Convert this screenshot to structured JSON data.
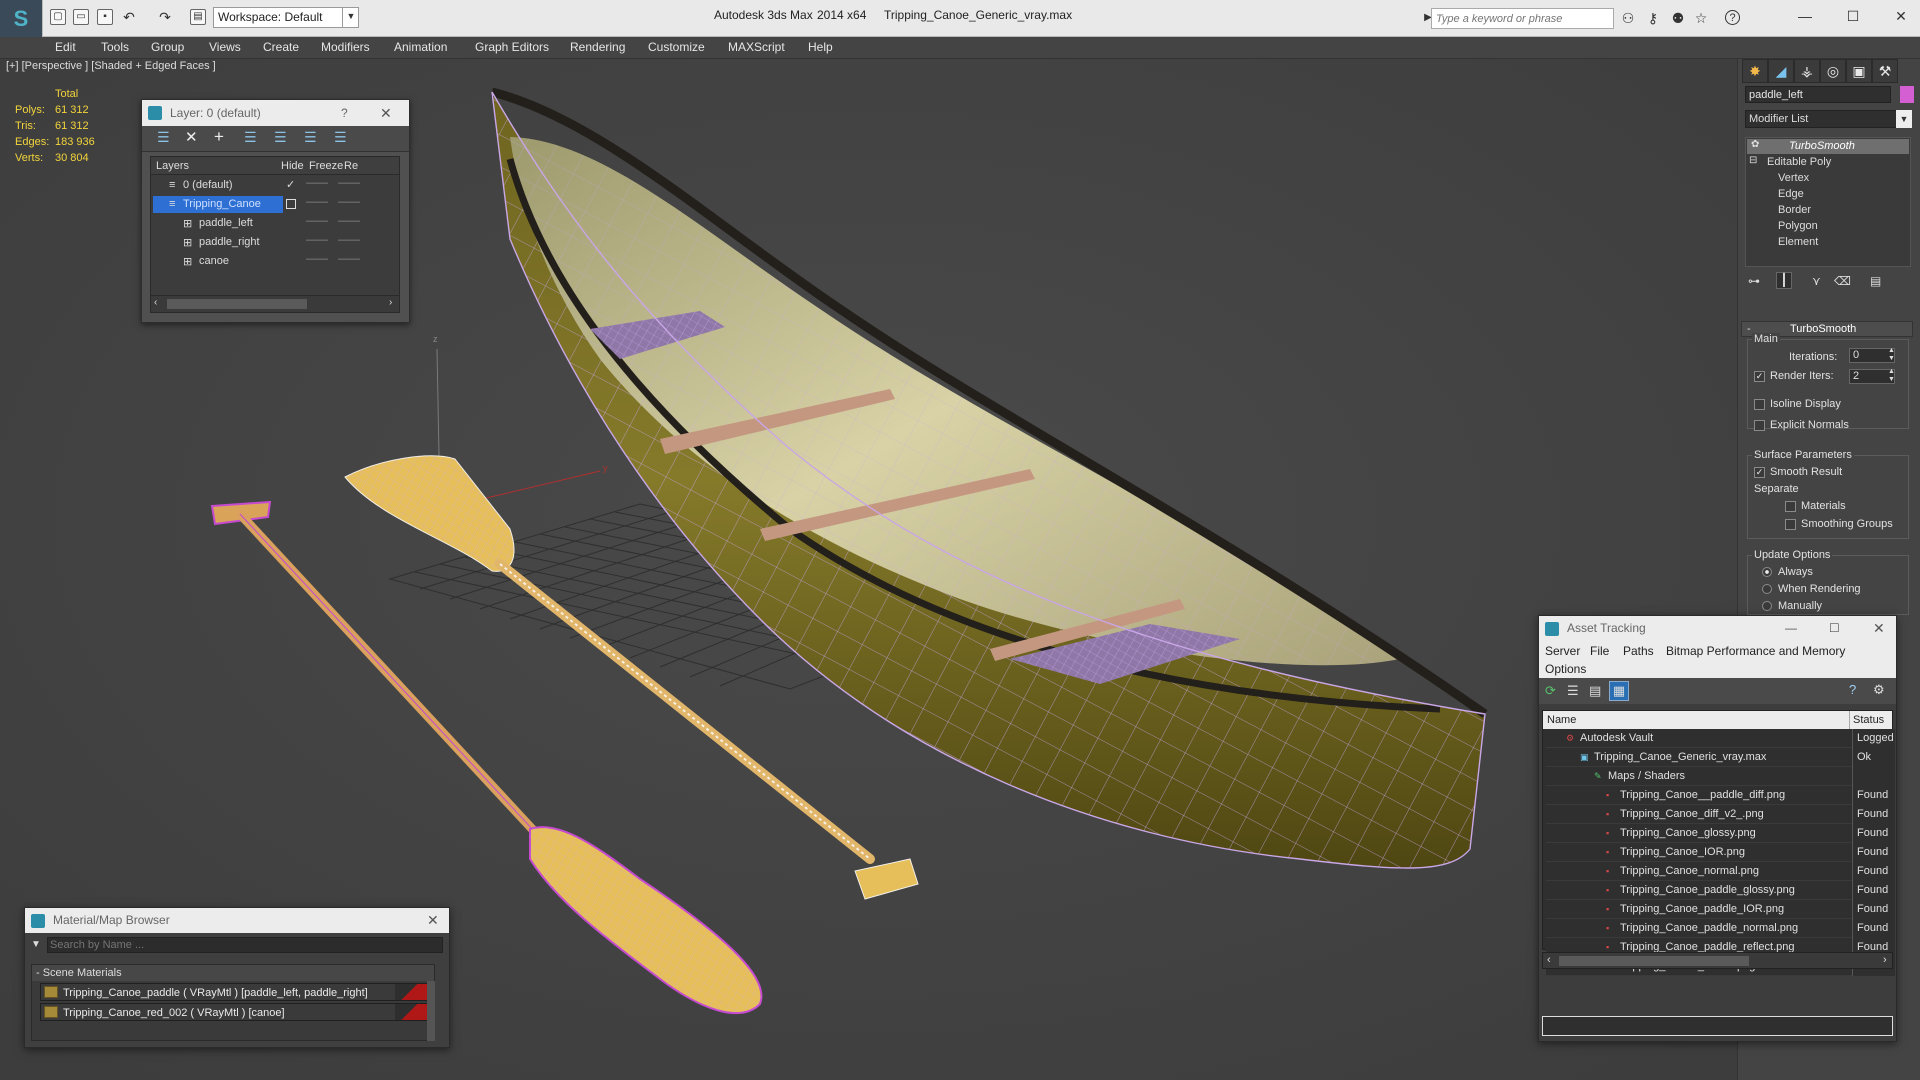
{
  "titlebar": {
    "workspace": "Workspace: Default",
    "app_title": "Autodesk 3ds Max",
    "version": "2014 x64",
    "file_name": "Tripping_Canoe_Generic_vray.max",
    "search_placeholder": "Type a keyword or phrase"
  },
  "menu": [
    "Edit",
    "Tools",
    "Group",
    "Views",
    "Create",
    "Modifiers",
    "Animation",
    "Graph Editors",
    "Rendering",
    "Customize",
    "MAXScript",
    "Help"
  ],
  "viewport": {
    "label": "[+] [Perspective ] [Shaded + Edged Faces ]",
    "stats": {
      "header": "Total",
      "polys_label": "Polys:",
      "polys": "61 312",
      "tris_label": "Tris:",
      "tris": "61 312",
      "edges_label": "Edges:",
      "edges": "183 936",
      "verts_label": "Verts:",
      "verts": "30 804"
    }
  },
  "layer_dialog": {
    "title": "Layer: 0 (default)",
    "help": "?",
    "columns": [
      "Layers",
      "Hide",
      "Freeze",
      "Re"
    ],
    "rows": [
      {
        "name": "0 (default)"
      },
      {
        "name": "Tripping_Canoe"
      },
      {
        "name": "paddle_left"
      },
      {
        "name": "paddle_right"
      },
      {
        "name": "canoe"
      }
    ]
  },
  "command_panel": {
    "object_name": "paddle_left",
    "object_color": "#d35fd3",
    "modifier_list": "Modifier List",
    "stack": [
      "TurboSmooth",
      "Editable Poly",
      "Vertex",
      "Edge",
      "Border",
      "Polygon",
      "Element"
    ],
    "rollout_title": "TurboSmooth",
    "main_group": "Main",
    "iterations_label": "Iterations:",
    "iterations": "0",
    "render_iters_label": "Render Iters:",
    "render_iters": "2",
    "isoline": "Isoline Display",
    "explicit_normals": "Explicit Normals",
    "surface_params": "Surface Parameters",
    "smooth_result": "Smooth Result",
    "separate": "Separate",
    "materials": "Materials",
    "smoothing_groups": "Smoothing Groups",
    "update_options": "Update Options",
    "always": "Always",
    "when_rendering": "When Rendering",
    "manually": "Manually"
  },
  "asset_tracking": {
    "title": "Asset Tracking",
    "menu": [
      "Server",
      "File",
      "Paths",
      "Bitmap Performance and Memory"
    ],
    "menu2": "Options",
    "col_name": "Name",
    "col_status": "Status",
    "rows": [
      {
        "name": "Autodesk Vault",
        "status": "Logged O"
      },
      {
        "name": "Tripping_Canoe_Generic_vray.max",
        "status": "Ok"
      },
      {
        "name": "Maps / Shaders",
        "status": ""
      },
      {
        "name": "Tripping_Canoe__paddle_diff.png",
        "status": "Found"
      },
      {
        "name": "Tripping_Canoe_diff_v2_.png",
        "status": "Found"
      },
      {
        "name": "Tripping_Canoe_glossy.png",
        "status": "Found"
      },
      {
        "name": "Tripping_Canoe_IOR.png",
        "status": "Found"
      },
      {
        "name": "Tripping_Canoe_normal.png",
        "status": "Found"
      },
      {
        "name": "Tripping_Canoe_paddle_glossy.png",
        "status": "Found"
      },
      {
        "name": "Tripping_Canoe_paddle_IOR.png",
        "status": "Found"
      },
      {
        "name": "Tripping_Canoe_paddle_normal.png",
        "status": "Found"
      },
      {
        "name": "Tripping_Canoe_paddle_reflect.png",
        "status": "Found"
      },
      {
        "name": "Tripping_Canoe_reflect.png",
        "status": "Found"
      }
    ]
  },
  "material_browser": {
    "title": "Material/Map Browser",
    "search_placeholder": "Search by Name ...",
    "group": "- Scene Materials",
    "items": [
      "Tripping_Canoe_paddle ( VRayMtl ) [paddle_left, paddle_right]",
      "Tripping_Canoe_red_002 ( VRayMtl ) [canoe]"
    ]
  }
}
